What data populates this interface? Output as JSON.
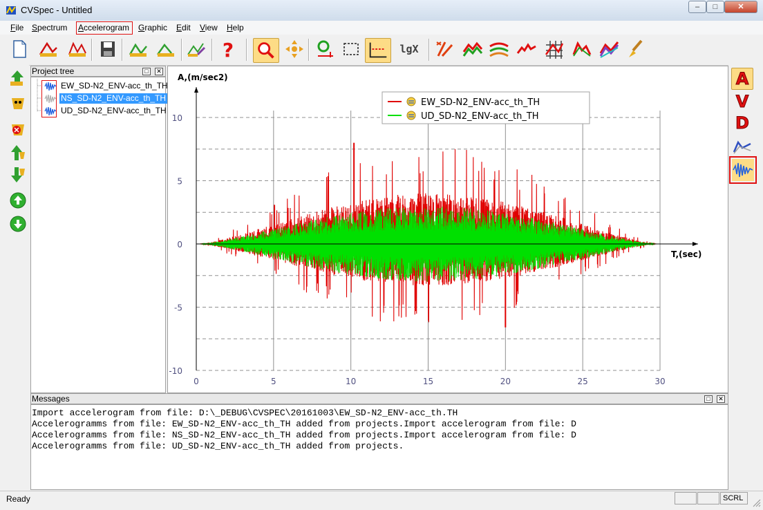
{
  "window": {
    "title": "CVSpec - Untitled"
  },
  "menu": [
    {
      "label": "File",
      "key": "F",
      "rest": "ile"
    },
    {
      "label": "Spectrum",
      "key": "S",
      "rest": "pectrum"
    },
    {
      "label": "Accelerogram",
      "key": "A",
      "rest": "ccelerogram"
    },
    {
      "label": "Graphic",
      "key": "G",
      "rest": "raphic"
    },
    {
      "label": "Edit",
      "key": "E",
      "rest": "dit"
    },
    {
      "label": "View",
      "key": "V",
      "rest": "iew"
    },
    {
      "label": "Help",
      "key": "H",
      "rest": "elp"
    }
  ],
  "toolbar": {
    "icons": [
      "new-document-icon",
      "open-spectrum-icon",
      "open-accelerogram-icon",
      "save-icon",
      "spectrum-tool-icon",
      "spectrum-tool2-icon",
      "edit-spectrum-icon",
      "help-icon",
      "zoom-icon",
      "pan-icon",
      "fit-icon",
      "select-region-icon",
      "axes-icon",
      "log-scale-icon",
      "compare-icon",
      "series-icon",
      "series2-icon",
      "peak-icon",
      "grid-icon",
      "spectra-icon",
      "spectra2-icon",
      "brush-icon"
    ],
    "log_label": "lgX"
  },
  "tree": {
    "title": "Project tree",
    "items": [
      {
        "label": "EW_SD-N2_ENV-acc_th_TH",
        "selected": false
      },
      {
        "label": "NS_SD-N2_ENV-acc_th_TH",
        "selected": true
      },
      {
        "label": "UD_SD-N2_ENV-acc_th_TH",
        "selected": false
      }
    ]
  },
  "chart_data": {
    "type": "line",
    "ylabel": "A,(m/sec2)",
    "xlabel": "T,(sec)",
    "xlim": [
      0,
      30
    ],
    "ylim": [
      -10,
      10
    ],
    "xticks": [
      0,
      5,
      10,
      15,
      20,
      25,
      30
    ],
    "yticks": [
      -10,
      -5,
      0,
      5,
      10
    ],
    "grid": true,
    "legend_position": "top-right",
    "series": [
      {
        "name": "EW_SD-N2_ENV-acc_th_TH",
        "color": "#e00000",
        "peak": 8.0,
        "trough": -6.6
      },
      {
        "name": "UD_SD-N2_ENV-acc_th_TH",
        "color": "#00e000",
        "peak": 3.0,
        "trough": -3.0
      }
    ]
  },
  "right_toolbar": {
    "labels": [
      "A",
      "V",
      "D"
    ],
    "icons": [
      "spectrum-line-icon",
      "accelerogram-wave-icon"
    ]
  },
  "messages": {
    "title": "Messages",
    "lines": [
      "Import accelerogram from file: D:\\_DEBUG\\CVSPEC\\20161003\\EW_SD-N2_ENV-acc_th.TH",
      "Accelerogramms from file: EW_SD-N2_ENV-acc_th_TH added from projects.Import accelerogram from file: D",
      "Accelerogramms from file: NS_SD-N2_ENV-acc_th_TH added from projects.Import accelerogram from file: D",
      "Accelerogramms from file: UD_SD-N2_ENV-acc_th_TH added from projects."
    ]
  },
  "status": {
    "text": "Ready",
    "scrl": "SCRL"
  }
}
